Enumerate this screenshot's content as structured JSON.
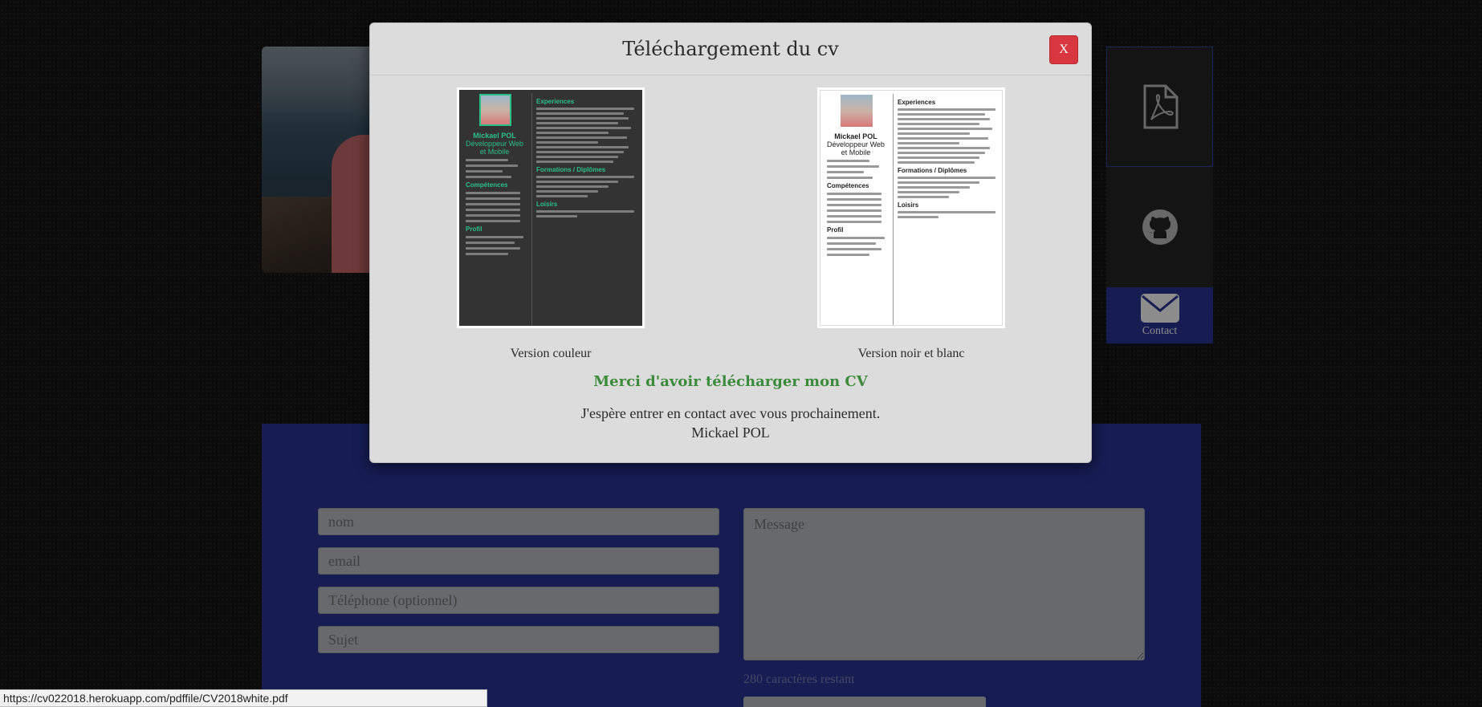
{
  "background": {
    "side_panel": {
      "contact_label": "Contact"
    },
    "form": {
      "name_placeholder": "nom",
      "email_placeholder": "email",
      "phone_placeholder": "Téléphone (optionnel)",
      "subject_placeholder": "Sujet",
      "message_placeholder": "Message",
      "chars_remaining": "280 caractères restant"
    }
  },
  "modal": {
    "title": "Téléchargement du cv",
    "close_label": "X",
    "color_version": {
      "caption": "Version couleur",
      "name": "Mickael POL",
      "role": "Développeur Web et Mobile"
    },
    "bw_version": {
      "caption": "Version noir et blanc",
      "name": "Mickael POL",
      "role": "Développeur Web et Mobile"
    },
    "cv_sections": {
      "experiences": "Experiences",
      "competences": "Compétences",
      "formations": "Formations / Diplômes",
      "profil": "Profil",
      "loisirs": "Loisirs"
    },
    "thanks": "Merci d'avoir télécharger mon CV",
    "message_line1": "J'espère entrer en contact avec vous prochainement.",
    "message_line2": "Mickael POL"
  },
  "status_bar": {
    "url": "https://cv022018.herokuapp.com/pdffile/CV2018white.pdf"
  },
  "colors": {
    "accent_green": "#3c8a3c",
    "close_red": "#d9373f",
    "contact_blue": "#2b3497"
  }
}
